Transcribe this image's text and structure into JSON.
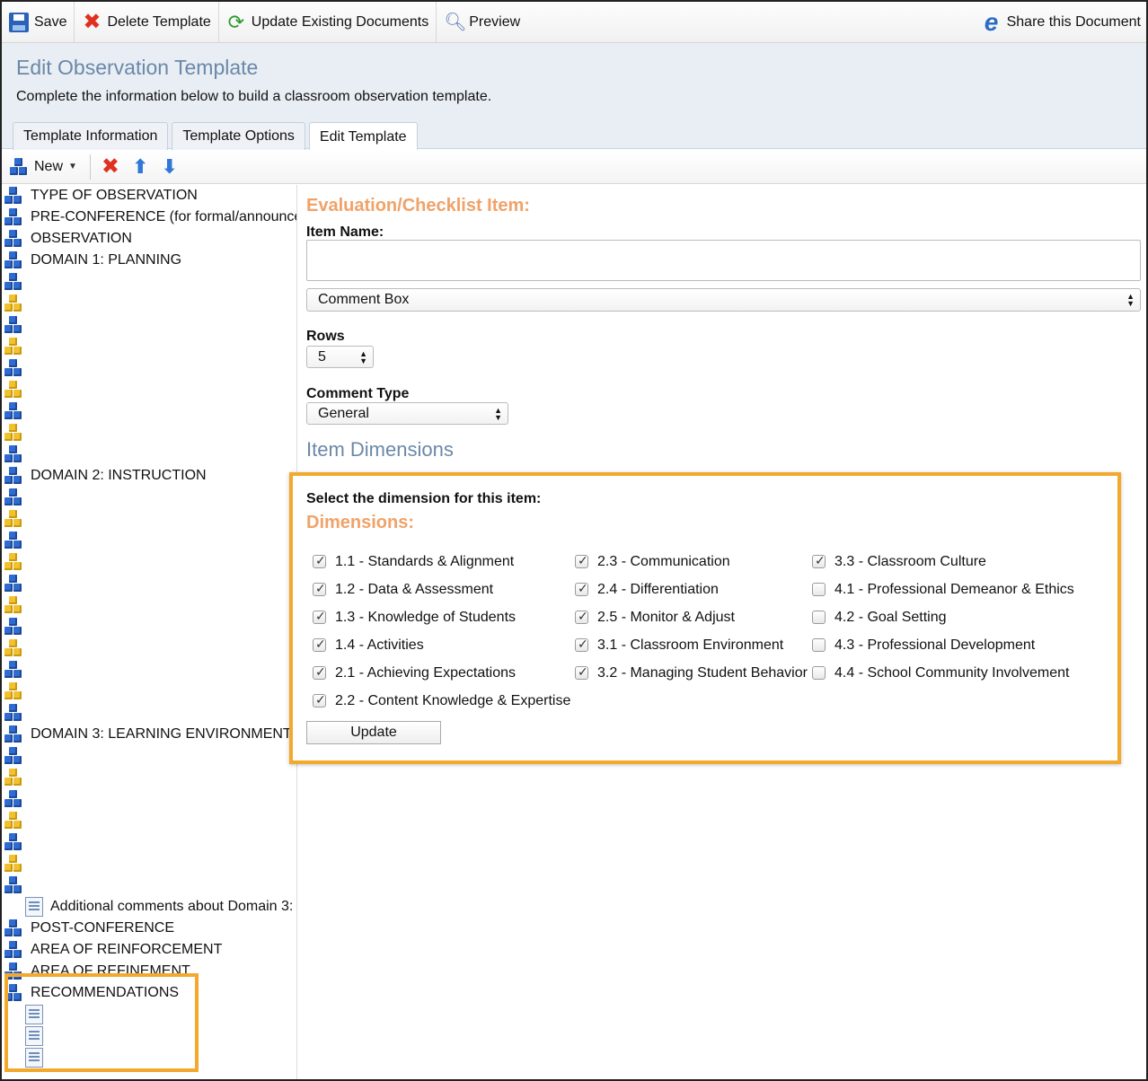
{
  "toolbar": {
    "save": "Save",
    "delete_template": "Delete Template",
    "update_existing": "Update Existing Documents",
    "preview": "Preview",
    "share": "Share this Document"
  },
  "header": {
    "title": "Edit Observation Template",
    "subtitle": "Complete the information below to build a classroom observation template.",
    "tabs": [
      {
        "label": "Template Information",
        "active": false
      },
      {
        "label": "Template Options",
        "active": false
      },
      {
        "label": "Edit Template",
        "active": true
      }
    ]
  },
  "tree_toolbar": {
    "new_label": "New"
  },
  "tree": [
    {
      "type": "blue",
      "label": "TYPE OF OBSERVATION"
    },
    {
      "type": "blue",
      "label": "PRE-CONFERENCE (for formal/announced"
    },
    {
      "type": "blue",
      "label": "OBSERVATION"
    },
    {
      "type": "blue",
      "label": "DOMAIN 1: PLANNING"
    },
    {
      "type": "blue",
      "label": ""
    },
    {
      "type": "yellow",
      "label": ""
    },
    {
      "type": "blue",
      "label": ""
    },
    {
      "type": "yellow",
      "label": ""
    },
    {
      "type": "blue",
      "label": ""
    },
    {
      "type": "yellow",
      "label": ""
    },
    {
      "type": "blue",
      "label": ""
    },
    {
      "type": "yellow",
      "label": ""
    },
    {
      "type": "blue",
      "label": ""
    },
    {
      "type": "blue",
      "label": "DOMAIN 2: INSTRUCTION"
    },
    {
      "type": "blue",
      "label": ""
    },
    {
      "type": "yellow",
      "label": ""
    },
    {
      "type": "blue",
      "label": ""
    },
    {
      "type": "yellow",
      "label": ""
    },
    {
      "type": "blue",
      "label": ""
    },
    {
      "type": "yellow",
      "label": ""
    },
    {
      "type": "blue",
      "label": ""
    },
    {
      "type": "yellow",
      "label": ""
    },
    {
      "type": "blue",
      "label": ""
    },
    {
      "type": "yellow",
      "label": ""
    },
    {
      "type": "blue",
      "label": ""
    },
    {
      "type": "blue",
      "label": "DOMAIN 3: LEARNING ENVIRONMENT"
    },
    {
      "type": "blue",
      "label": ""
    },
    {
      "type": "yellow",
      "label": ""
    },
    {
      "type": "blue",
      "label": ""
    },
    {
      "type": "yellow",
      "label": ""
    },
    {
      "type": "blue",
      "label": ""
    },
    {
      "type": "yellow",
      "label": ""
    },
    {
      "type": "blue",
      "label": ""
    },
    {
      "type": "doc",
      "label": "Additional comments about Domain 3:"
    },
    {
      "type": "blue",
      "label": "POST-CONFERENCE"
    },
    {
      "type": "blue",
      "label": "AREA OF REINFORCEMENT"
    },
    {
      "type": "blue",
      "label": "AREA OF REFINEMENT"
    },
    {
      "type": "blue",
      "label": "RECOMMENDATIONS"
    },
    {
      "type": "doc",
      "label": ""
    },
    {
      "type": "doc",
      "label": ""
    },
    {
      "type": "doc",
      "label": ""
    }
  ],
  "form": {
    "section_title": "Evaluation/Checklist Item:",
    "item_name_label": "Item Name:",
    "item_name_value": "",
    "item_type": "Comment Box",
    "rows_label": "Rows",
    "rows_value": "5",
    "comment_type_label": "Comment Type",
    "comment_type_value": "General",
    "dimensions_title": "Item Dimensions"
  },
  "dimensions": {
    "prompt": "Select the dimension for this item:",
    "heading": "Dimensions:",
    "update_label": "Update",
    "columns": [
      [
        {
          "label": "1.1 - Standards & Alignment",
          "checked": true
        },
        {
          "label": "1.2 - Data & Assessment",
          "checked": true
        },
        {
          "label": "1.3 - Knowledge of Students",
          "checked": true
        },
        {
          "label": "1.4 - Activities",
          "checked": true
        },
        {
          "label": "2.1 - Achieving Expectations",
          "checked": true
        },
        {
          "label": "2.2 - Content Knowledge & Expertise",
          "checked": true
        }
      ],
      [
        {
          "label": "2.3 - Communication",
          "checked": true
        },
        {
          "label": "2.4 - Differentiation",
          "checked": true
        },
        {
          "label": "2.5 - Monitor & Adjust",
          "checked": true
        },
        {
          "label": "3.1 - Classroom Environment",
          "checked": true
        },
        {
          "label": "3.2 - Managing Student Behavior",
          "checked": true
        }
      ],
      [
        {
          "label": "3.3 - Classroom Culture",
          "checked": true
        },
        {
          "label": "4.1 - Professional Demeanor & Ethics",
          "checked": false
        },
        {
          "label": "4.2 - Goal Setting",
          "checked": false
        },
        {
          "label": "4.3 - Professional Development",
          "checked": false
        },
        {
          "label": "4.4 - School Community Involvement",
          "checked": false
        }
      ]
    ]
  },
  "colors": {
    "accent_orange": "#f0a268",
    "highlight_border": "#f2a92c",
    "title_blue": "#6b88a8"
  }
}
